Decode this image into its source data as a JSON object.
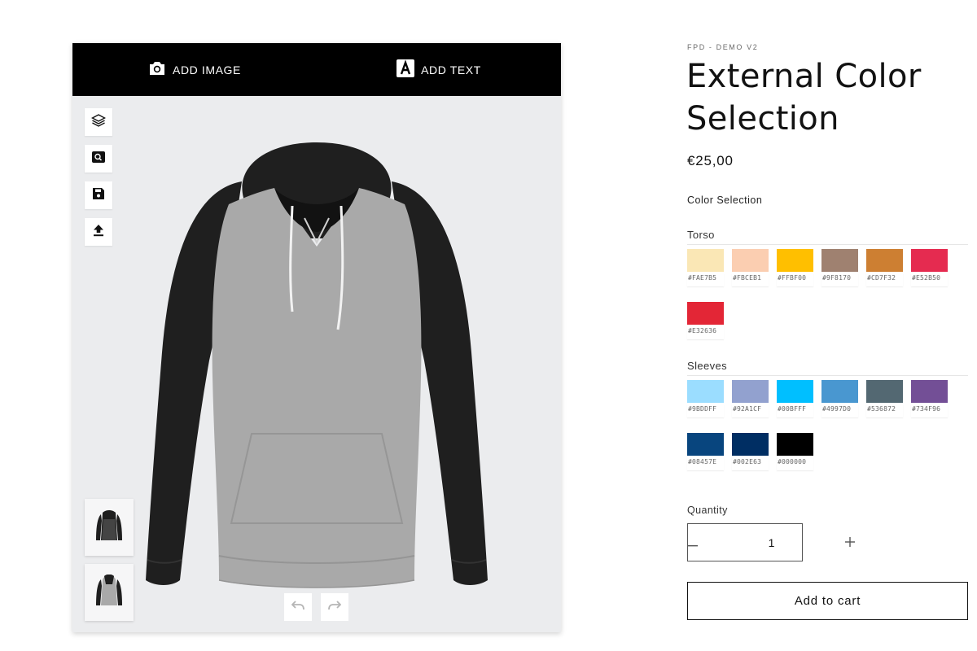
{
  "designer": {
    "add_image_label": "ADD IMAGE",
    "add_text_label": "ADD TEXT",
    "tools": [
      "layers-icon",
      "zoom-icon",
      "save-icon",
      "upload-icon"
    ],
    "views": [
      "hoodie-front-view",
      "hoodie-back-view"
    ],
    "history": [
      "undo-icon",
      "redo-icon"
    ],
    "torso_color": "#a9a9a9",
    "sleeve_color": "#1f1f1f"
  },
  "product": {
    "vendor": "FPD - DEMO V2",
    "title": "External Color Selection",
    "price": "€25,00",
    "color_selection_label": "Color Selection",
    "groups": [
      {
        "name": "Torso",
        "colors": [
          "#FAE7B5",
          "#FBCEB1",
          "#FFBF00",
          "#9F8170",
          "#CD7F32",
          "#E52B50",
          "#E32636"
        ]
      },
      {
        "name": "Sleeves",
        "colors": [
          "#9BDDFF",
          "#92A1CF",
          "#00BFFF",
          "#4997D0",
          "#536872",
          "#734F96",
          "#08457E",
          "#002E63",
          "#000000"
        ]
      }
    ],
    "quantity_label": "Quantity",
    "quantity_value": "1",
    "add_to_cart_label": "Add to cart"
  }
}
